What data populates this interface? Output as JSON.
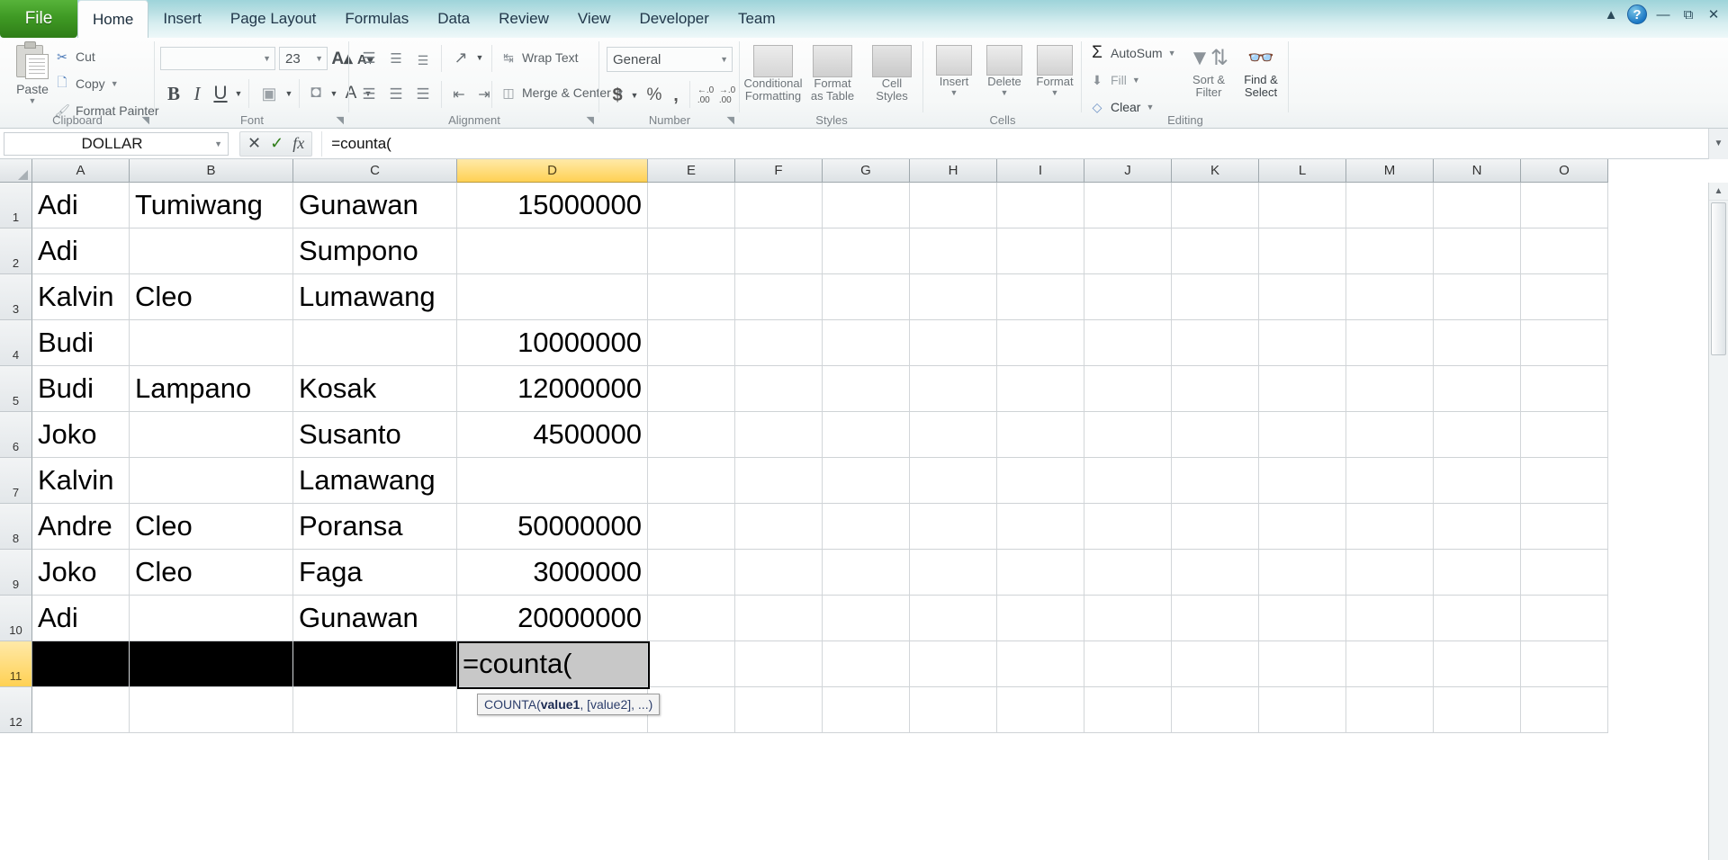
{
  "window": {
    "minimize_icon": "minimize-icon",
    "restore_icon": "restore-icon",
    "close_icon": "close-icon",
    "help_label": "?",
    "collapse_icon": "collapse-ribbon-icon"
  },
  "tabs": [
    {
      "label": "File",
      "active": false,
      "file": true
    },
    {
      "label": "Home",
      "active": true
    },
    {
      "label": "Insert",
      "active": false
    },
    {
      "label": "Page Layout",
      "active": false
    },
    {
      "label": "Formulas",
      "active": false
    },
    {
      "label": "Data",
      "active": false
    },
    {
      "label": "Review",
      "active": false
    },
    {
      "label": "View",
      "active": false
    },
    {
      "label": "Developer",
      "active": false
    },
    {
      "label": "Team",
      "active": false
    }
  ],
  "ribbon": {
    "clipboard": {
      "group_label": "Clipboard",
      "paste": "Paste",
      "cut": "Cut",
      "copy": "Copy",
      "format_painter": "Format Painter"
    },
    "font": {
      "group_label": "Font",
      "font_name": "",
      "font_size": "23",
      "bold": "B",
      "italic": "I",
      "underline": "U",
      "grow_font": "A",
      "shrink_font": "A"
    },
    "alignment": {
      "group_label": "Alignment",
      "wrap_text": "Wrap Text",
      "merge_center": "Merge & Center"
    },
    "number": {
      "group_label": "Number",
      "format": "General",
      "currency": "$",
      "percent": "%",
      "comma": ","
    },
    "styles": {
      "group_label": "Styles",
      "conditional_formatting": "Conditional\nFormatting",
      "conditional_formatting_l1": "Conditional",
      "conditional_formatting_l2": "Formatting",
      "format_as_table_l1": "Format",
      "format_as_table_l2": "as Table",
      "cell_styles_l1": "Cell",
      "cell_styles_l2": "Styles"
    },
    "cells": {
      "group_label": "Cells",
      "insert": "Insert",
      "delete": "Delete",
      "format": "Format"
    },
    "editing": {
      "group_label": "Editing",
      "autosum": "AutoSum",
      "fill": "Fill",
      "clear": "Clear",
      "sort_filter_l1": "Sort &",
      "sort_filter_l2": "Filter",
      "find_select_l1": "Find &",
      "find_select_l2": "Select"
    }
  },
  "formula_bar": {
    "name_box": "DOLLAR",
    "cancel_icon": "cancel-icon",
    "enter_icon": "enter-icon",
    "function_icon": "insert-function-icon",
    "formula": "=counta("
  },
  "sheet": {
    "columns": [
      "A",
      "B",
      "C",
      "D",
      "E",
      "F",
      "G",
      "H",
      "I",
      "J",
      "K",
      "L",
      "M",
      "N",
      "O"
    ],
    "selected_column": "D",
    "selected_row": "11",
    "rows": [
      "1",
      "2",
      "3",
      "4",
      "5",
      "6",
      "7",
      "8",
      "9",
      "10",
      "11",
      "12"
    ],
    "data": [
      {
        "A": "Adi",
        "B": "Tumiwang",
        "C": "Gunawan",
        "D": "15000000"
      },
      {
        "A": "Adi",
        "B": "",
        "C": "Sumpono",
        "D": ""
      },
      {
        "A": "Kalvin",
        "B": "Cleo",
        "C": "Lumawang",
        "D": ""
      },
      {
        "A": "Budi",
        "B": "",
        "C": "",
        "D": "10000000"
      },
      {
        "A": "Budi",
        "B": "Lampano",
        "C": "Kosak",
        "D": "12000000"
      },
      {
        "A": "Joko",
        "B": "",
        "C": "Susanto",
        "D": "4500000"
      },
      {
        "A": "Kalvin",
        "B": "",
        "C": "Lamawang",
        "D": ""
      },
      {
        "A": "Andre",
        "B": "Cleo",
        "C": "Poransa",
        "D": "50000000"
      },
      {
        "A": "Joko",
        "B": "Cleo",
        "C": "Faga",
        "D": "3000000"
      },
      {
        "A": "Adi",
        "B": "",
        "C": "Gunawan",
        "D": "20000000"
      },
      {
        "A": "",
        "B": "",
        "C": "",
        "D": "=counta("
      },
      {
        "A": "",
        "B": "",
        "C": "",
        "D": ""
      }
    ],
    "editing_cell": "D11",
    "black_fill_row": "11",
    "tooltip_prefix": "COUNTA(",
    "tooltip_bold": "value1",
    "tooltip_suffix": ", [value2], ...)"
  },
  "colors": {
    "file_tab_green": "#3f9a24",
    "selected_header": "#ffd154",
    "title_gradient_top": "#9ed4da",
    "editing_cell_bg": "#c8c8c8",
    "black_fill": "#000000"
  }
}
